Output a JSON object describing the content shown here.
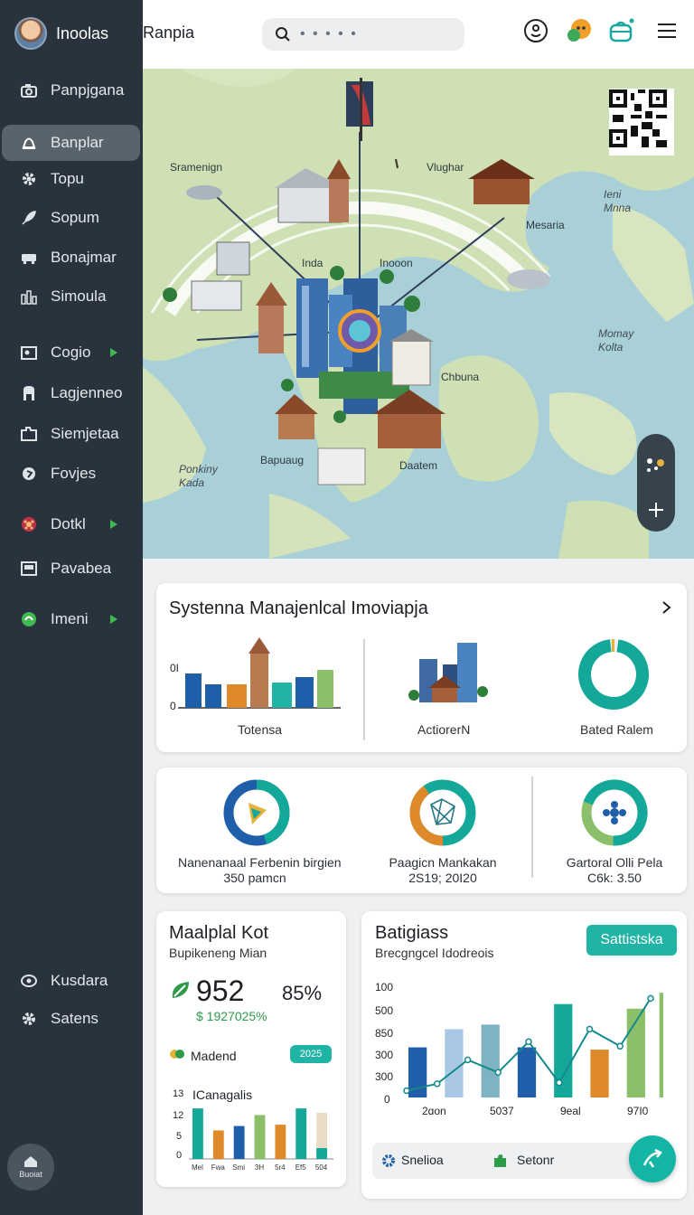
{
  "user": {
    "name": "Inoolas"
  },
  "app": {
    "title": "Ranpia"
  },
  "search": {
    "placeholder": "• • • • •"
  },
  "sidebar": {
    "items": [
      {
        "label": "Panpjgana",
        "icon": "camera-icon"
      },
      {
        "label": "Banplar",
        "icon": "bell-icon",
        "active": true
      },
      {
        "label": "Topu",
        "icon": "gear-icon"
      },
      {
        "label": "Sopum",
        "icon": "rocket-icon"
      },
      {
        "label": "Bonajmar",
        "icon": "truck-icon"
      },
      {
        "label": "Simoula",
        "icon": "bar-chart-icon"
      },
      {
        "label": "Cogio",
        "icon": "image-icon",
        "expandable": true
      },
      {
        "label": "Lagjenneo",
        "icon": "a-letter-icon"
      },
      {
        "label": "Siemjetaa",
        "icon": "folder-icon"
      },
      {
        "label": "Fovjes",
        "icon": "badge-icon"
      },
      {
        "label": "Dotkl",
        "icon": "flower-icon",
        "expandable": true
      },
      {
        "label": "Pavabea",
        "icon": "photo-icon"
      },
      {
        "label": "Imeni",
        "icon": "leaf-icon",
        "expandable": true
      }
    ],
    "footer": [
      {
        "label": "Kusdara",
        "icon": "eye-icon"
      },
      {
        "label": "Satens",
        "icon": "settings-icon"
      }
    ],
    "badge_label": "Buoiat"
  },
  "map": {
    "labels": [
      "Sramenign",
      "Vlughar",
      "Ieni Mnna",
      "Mesaria",
      "Inda",
      "Inooon",
      "Momay Kolta",
      "Chbuna",
      "Ponkiny Kada",
      "Bapuaug",
      "Daatem"
    ]
  },
  "overview": {
    "title": "Systenna Manajenlcal Imoviapja",
    "axis_top": "0I",
    "axis_bottom": "0",
    "items": [
      "Totensa",
      "ActiorerN",
      "Bated Ralem"
    ],
    "donut_value": 0.96
  },
  "stats": [
    {
      "label": "Nanenanaal Ferbenin birgien",
      "sub": "350 pamcn",
      "value": 0.45
    },
    {
      "label": "Paagicn Mankakan",
      "sub": "2S19; 20I20",
      "value": 0.4
    },
    {
      "label": "Gartoral Olli Pela",
      "sub": "C6k: 3.50",
      "value": 0.7
    }
  ],
  "kpi": {
    "title": "Maalplal Kot",
    "subtitle": "Bupikeneng Mian",
    "number": "952",
    "percent": "85%",
    "change": "$ 1927025%",
    "legend": "Madend",
    "badge": "2025",
    "chart_title": "ICanagalis",
    "chart_data": {
      "type": "bar",
      "categories": [
        "Mel",
        "Fwa",
        "Smi",
        "3H",
        "5r4",
        "Ef5",
        "504"
      ],
      "values": [
        11.5,
        6.5,
        7.5,
        10,
        7.8,
        11.5,
        10.5
      ],
      "yticks": [
        "13",
        "12",
        "5",
        "0"
      ],
      "ylim": [
        0,
        14
      ]
    }
  },
  "analytics": {
    "title": "Batigiass",
    "subtitle": "Brecgngcel Idodreois",
    "button": "Sattistska",
    "chart_data": {
      "type": "bar",
      "yticks": [
        "100",
        "500",
        "850",
        "300",
        "300",
        "0"
      ],
      "xticks": [
        "2ɑon",
        "5037",
        "9eal",
        "97I0"
      ],
      "ylim": [
        0,
        100
      ],
      "values": [
        44,
        60,
        64,
        44,
        82,
        42,
        78
      ],
      "line": [
        6,
        12,
        33,
        22,
        49,
        13,
        60,
        45,
        87
      ]
    },
    "footer": [
      {
        "label": "Snelioa",
        "icon": "gear-icon"
      },
      {
        "label": "Setonr",
        "icon": "puzzle-icon"
      }
    ]
  },
  "colors": {
    "sidebar": "#28333d",
    "teal": "#14a89a",
    "orange": "#df8a2a",
    "blue": "#1f5ea8",
    "green": "#8bbf6a"
  }
}
